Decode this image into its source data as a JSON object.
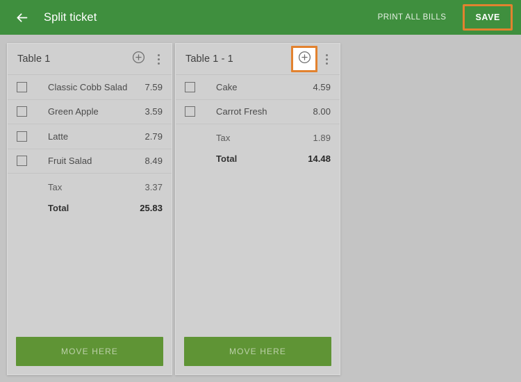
{
  "appbar": {
    "back_icon": "arrow-left-icon",
    "title": "Split ticket",
    "print_label": "PRINT ALL BILLS",
    "save_label": "SAVE",
    "bg_color": "#3f8f3e",
    "highlight_color": "#e2822f"
  },
  "tickets": [
    {
      "title": "Table 1",
      "add_icon": "plus-circle-icon",
      "menu_icon": "more-vertical-icon",
      "add_highlighted": false,
      "items": [
        {
          "name": "Classic Cobb Salad",
          "price": "7.59",
          "checked": false
        },
        {
          "name": "Green Apple",
          "price": "3.59",
          "checked": false
        },
        {
          "name": "Latte",
          "price": "2.79",
          "checked": false
        },
        {
          "name": "Fruit Salad",
          "price": "8.49",
          "checked": false
        }
      ],
      "tax_label": "Tax",
      "tax_value": "3.37",
      "total_label": "Total",
      "total_value": "25.83",
      "move_label": "MOVE HERE"
    },
    {
      "title": "Table 1 - 1",
      "add_icon": "plus-circle-icon",
      "menu_icon": "more-vertical-icon",
      "add_highlighted": true,
      "items": [
        {
          "name": "Cake",
          "price": "4.59",
          "checked": false
        },
        {
          "name": "Carrot Fresh",
          "price": "8.00",
          "checked": false
        }
      ],
      "tax_label": "Tax",
      "tax_value": "1.89",
      "total_label": "Total",
      "total_value": "14.48",
      "move_label": "MOVE HERE"
    }
  ]
}
